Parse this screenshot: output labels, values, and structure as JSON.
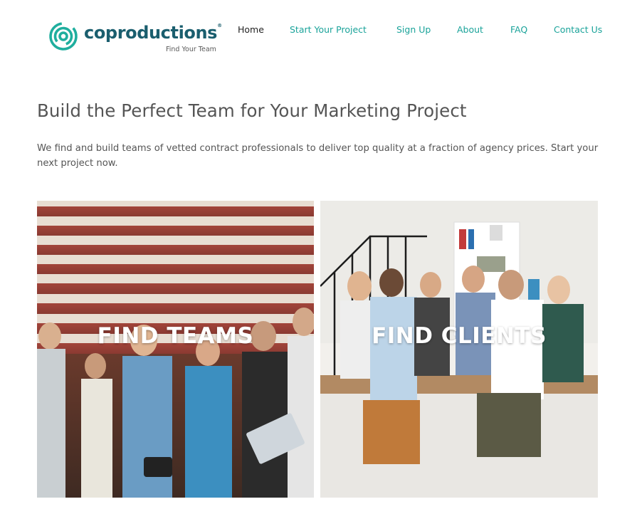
{
  "brand": {
    "name": "coproductions",
    "registered_mark": "®",
    "tagline": "Find Your Team",
    "logo_icon": "concentric-rings-logo-icon",
    "colors": {
      "primary": "#1a5e6e",
      "accent": "#1aa39a",
      "text": "#555555"
    }
  },
  "nav": {
    "items": [
      {
        "label": "Home",
        "active": true
      },
      {
        "label": "Start Your Project",
        "active": false
      },
      {
        "label": "Sign Up",
        "active": false
      },
      {
        "label": "About",
        "active": false
      },
      {
        "label": "FAQ",
        "active": false
      },
      {
        "label": "Contact Us",
        "active": false
      }
    ]
  },
  "hero": {
    "title": "Build the Perfect Team for Your Marketing Project",
    "intro": "We find and build teams of vetted contract professionals to deliver top quality at a fraction of agency prices. Start your next project now."
  },
  "cards": [
    {
      "label": "FIND TEAMS",
      "image": "group-of-young-professionals-photo"
    },
    {
      "label": "FIND CLIENTS",
      "image": "team-meeting-at-table-photo"
    }
  ]
}
